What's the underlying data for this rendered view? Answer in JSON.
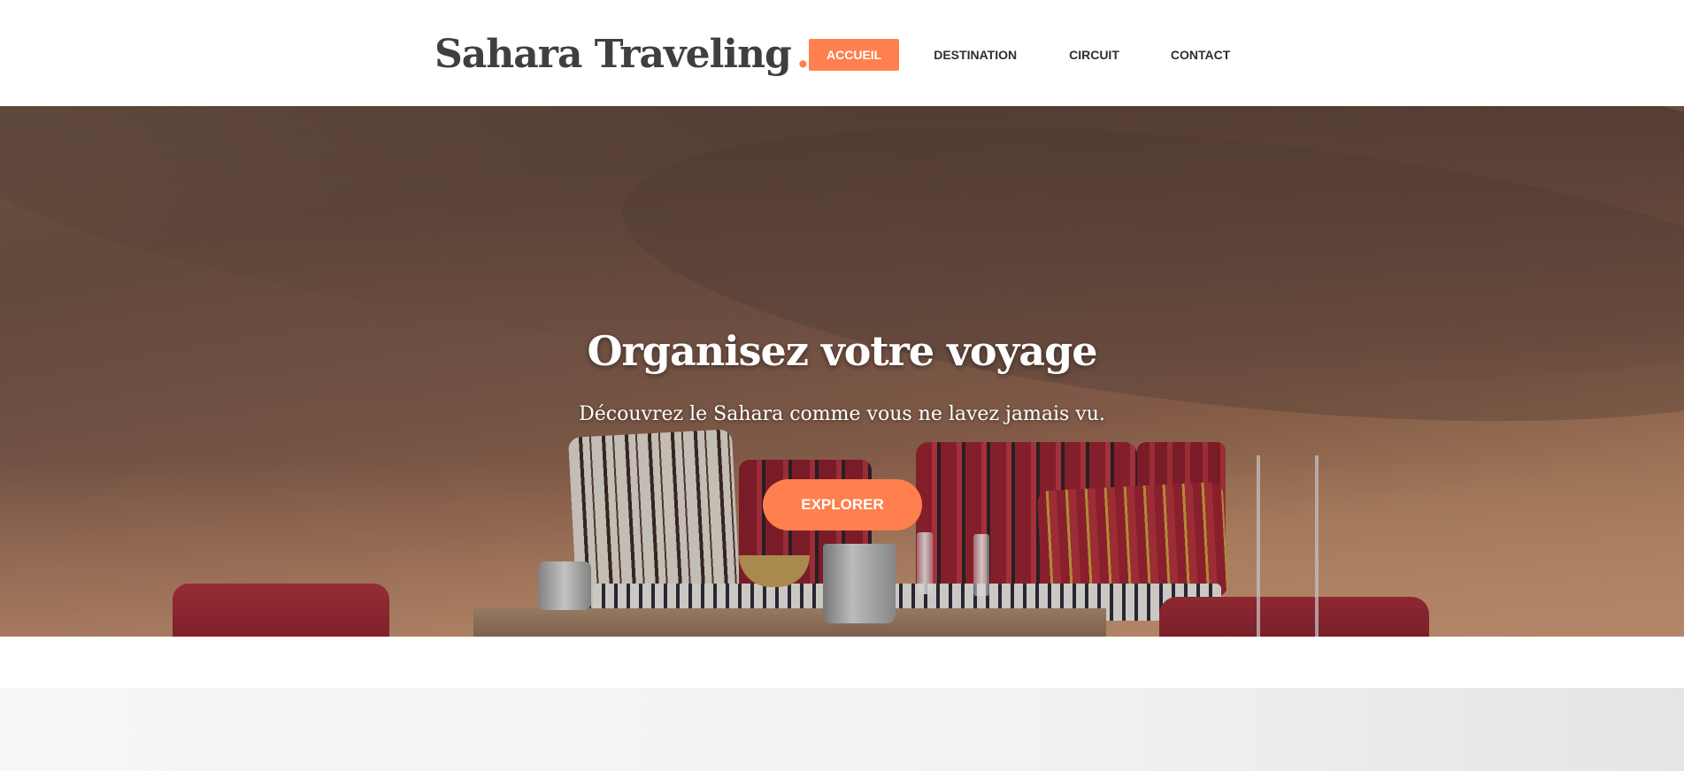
{
  "header": {
    "logo_text": "Sahara Traveling",
    "logo_dot": ".",
    "nav": [
      {
        "label": "ACCUEIL",
        "active": true
      },
      {
        "label": "DESTINATION",
        "active": false
      },
      {
        "label": "CIRCUIT",
        "active": false
      },
      {
        "label": "CONTACT",
        "active": false
      }
    ]
  },
  "hero": {
    "title": "Organisez votre voyage",
    "subtitle": "Découvrez le Sahara comme vous ne lavez jamais vu.",
    "cta_label": "EXPLORER"
  },
  "colors": {
    "accent": "#ff7f4e",
    "text_dark": "#3f3f3f",
    "white": "#ffffff"
  }
}
